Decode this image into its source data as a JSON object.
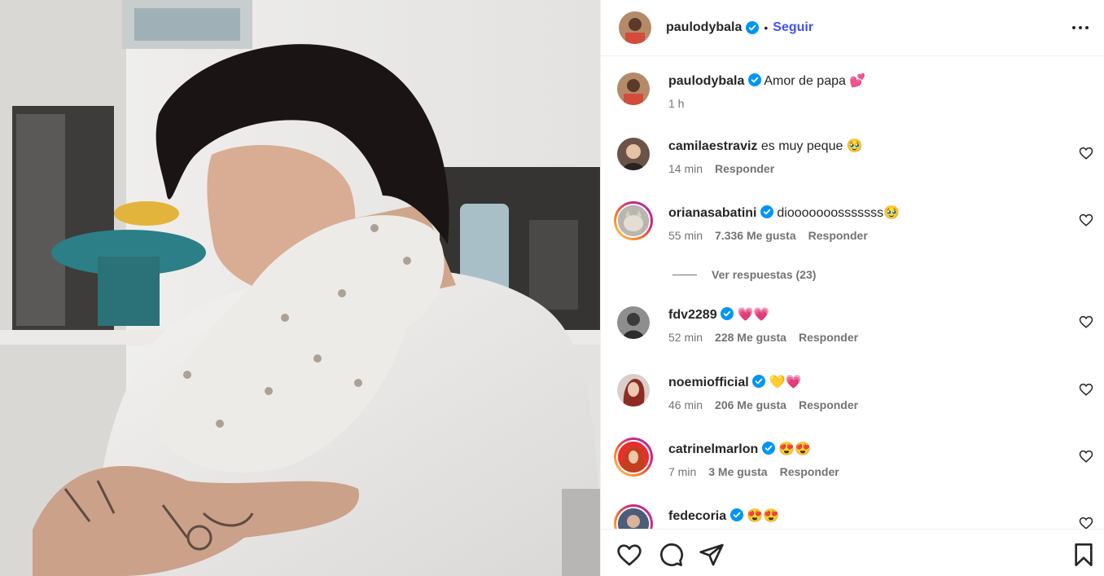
{
  "post": {
    "author": "paulodybala",
    "follow_label": "Seguir",
    "separator": "•",
    "caption": "Amor de papa 💕",
    "time": "1 h"
  },
  "comments": [
    {
      "user": "camilaestraviz",
      "verified": false,
      "text": "es muy peque 🥹",
      "time": "14 min",
      "likes": "",
      "reply": "Responder"
    },
    {
      "user": "orianasabatini",
      "verified": true,
      "text": "diooooooosssssss🥹",
      "time": "55 min",
      "likes": "7.336 Me gusta",
      "reply": "Responder"
    },
    {
      "user": "fdv2289",
      "verified": true,
      "text": "💗💗",
      "time": "52 min",
      "likes": "228 Me gusta",
      "reply": "Responder"
    },
    {
      "user": "noemiofficial",
      "verified": true,
      "text": "💛💗",
      "time": "46 min",
      "likes": "206 Me gusta",
      "reply": "Responder"
    },
    {
      "user": "catrinelmarlon",
      "verified": true,
      "text": "😍😍",
      "time": "7 min",
      "likes": "3 Me gusta",
      "reply": "Responder"
    },
    {
      "user": "fedecoria",
      "verified": true,
      "text": "😍😍",
      "time": "",
      "likes": "",
      "reply": ""
    }
  ],
  "view_replies": "Ver respuestas (23)",
  "colors": {
    "accent": "#4150f7",
    "verified": "#0095f6",
    "muted": "#737373"
  },
  "icons": [
    "verified-badge-icon",
    "more-options-icon",
    "like-icon",
    "comment-icon",
    "share-icon",
    "save-icon"
  ]
}
